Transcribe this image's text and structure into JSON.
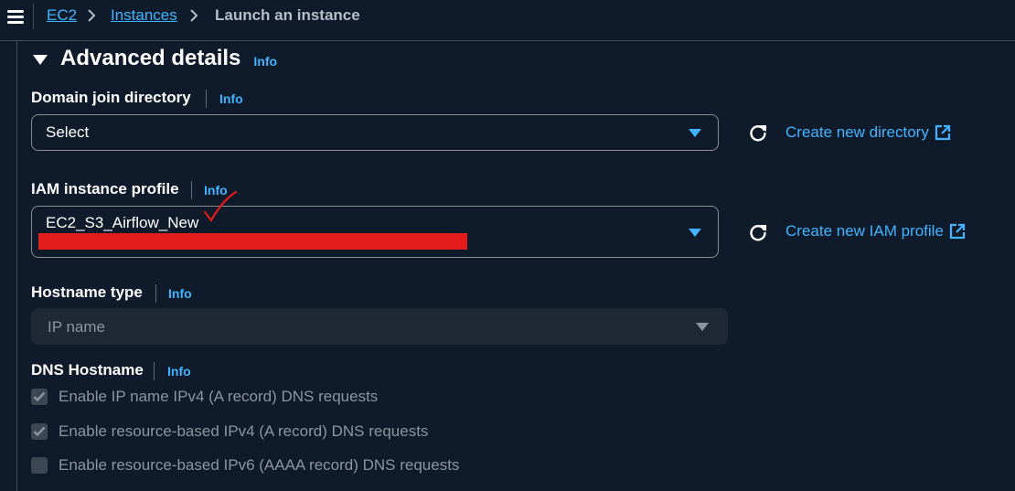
{
  "breadcrumb": {
    "items": [
      "EC2",
      "Instances"
    ],
    "current": "Launch an instance"
  },
  "section": {
    "title": "Advanced details",
    "info": "Info"
  },
  "domain_join": {
    "label": "Domain join directory",
    "info": "Info",
    "value": "Select",
    "create_link": "Create new directory"
  },
  "iam_profile": {
    "label": "IAM instance profile",
    "info": "Info",
    "value": "EC2_S3_Airflow_New",
    "create_link": "Create new IAM profile"
  },
  "hostname_type": {
    "label": "Hostname type",
    "info": "Info",
    "value": "IP name"
  },
  "dns_hostname": {
    "label": "DNS Hostname",
    "info": "Info",
    "options": [
      {
        "label": "Enable IP name IPv4 (A record) DNS requests",
        "checked": true
      },
      {
        "label": "Enable resource-based IPv4 (A record) DNS requests",
        "checked": true
      },
      {
        "label": "Enable resource-based IPv6 (AAAA record) DNS requests",
        "checked": false
      }
    ]
  },
  "colors": {
    "link": "#42b4ff",
    "background": "#0f1b2a",
    "redaction": "#e41b1b"
  }
}
